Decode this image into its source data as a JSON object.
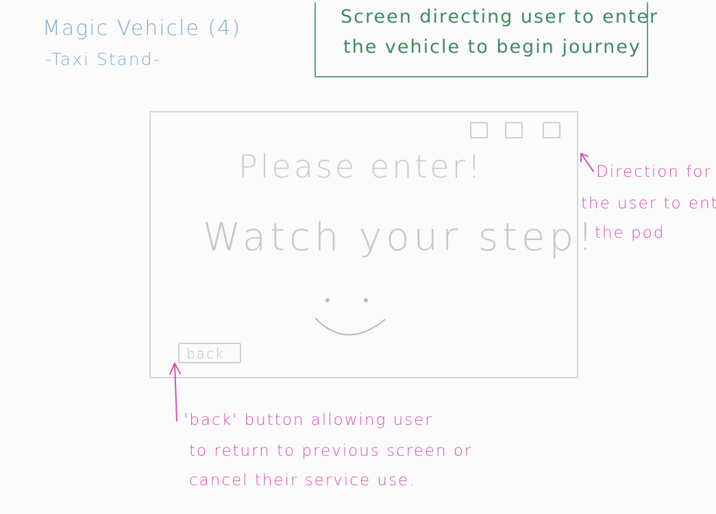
{
  "header": {
    "title": "Magic Vehicle (4)",
    "subtitle": "-Taxi Stand-"
  },
  "green_note": {
    "line1": "Screen directing user to enter",
    "line2": "the vehicle to begin journey"
  },
  "screen": {
    "line1": "Please enter!",
    "line2": "Watch your step!",
    "back_label": "back"
  },
  "annotations": {
    "right": [
      "Direction for",
      "the user to enter",
      "the pod"
    ],
    "bottom": [
      "'back' button allowing user",
      "to return to previous screen or",
      "cancel their service use."
    ]
  },
  "colors": {
    "blue_text": "#7eaed0",
    "green_text": "#3f8a5f",
    "pink_text": "#d64fb3",
    "sketch_gray": "#c6c6c6"
  }
}
